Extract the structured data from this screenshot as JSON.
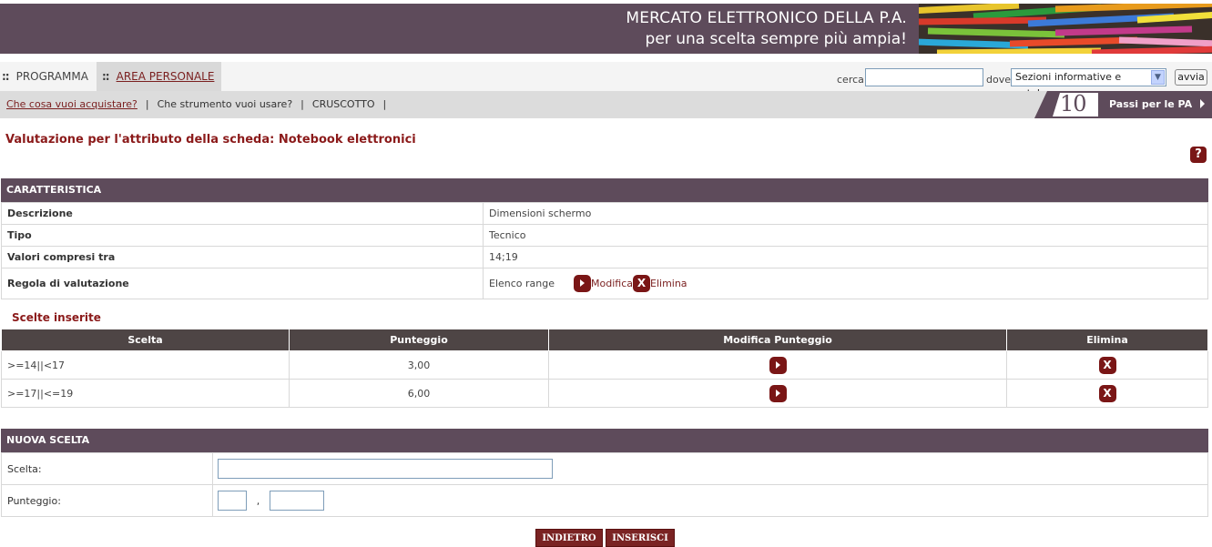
{
  "banner": {
    "line1": "MERCATO ELETTRONICO DELLA P.A.",
    "line2": "per una scelta sempre più ampia!"
  },
  "nav": {
    "tabs": [
      {
        "label": "PROGRAMMA"
      },
      {
        "label": "AREA PERSONALE"
      }
    ],
    "search_label": "cerca",
    "search_value": "",
    "where_label": "dove",
    "where_selected": "Sezioni informative e catalogo",
    "go_label": "avvia"
  },
  "subnav": {
    "links": [
      "Che cosa vuoi acquistare?",
      "Che strumento vuoi usare?",
      "CRUSCOTTO"
    ],
    "separator": "|",
    "passi_number": "10",
    "passi_label": "Passi per le PA"
  },
  "page": {
    "title": "Valutazione per l'attributo della scheda: Notebook elettronici",
    "help": "?"
  },
  "caratteristica": {
    "header": "CARATTERISTICA",
    "rows": [
      {
        "label": "Descrizione",
        "value": "Dimensioni schermo"
      },
      {
        "label": "Tipo",
        "value": "Tecnico"
      },
      {
        "label": "Valori compresi tra",
        "value": "14;19"
      },
      {
        "label": "Regola di valutazione",
        "value": "Elenco range",
        "modifica": "Modifica",
        "elimina": "Elimina"
      }
    ]
  },
  "scelte": {
    "title": "Scelte inserite",
    "columns": [
      "Scelta",
      "Punteggio",
      "Modifica Punteggio",
      "Elimina"
    ],
    "rows": [
      {
        "scelta": ">=14||<17",
        "punteggio": "3,00"
      },
      {
        "scelta": ">=17||<=19",
        "punteggio": "6,00"
      }
    ]
  },
  "nuova": {
    "header": "NUOVA SCELTA",
    "scelta_label": "Scelta:",
    "punteggio_label": "Punteggio:",
    "decimal_sep": ","
  },
  "buttons": {
    "indietro": "INDIETRO",
    "inserisci": "INSERISCI"
  },
  "colors": {
    "brand": "#5e4b5b",
    "accent": "#7a1616",
    "title": "#8b1a1a"
  }
}
